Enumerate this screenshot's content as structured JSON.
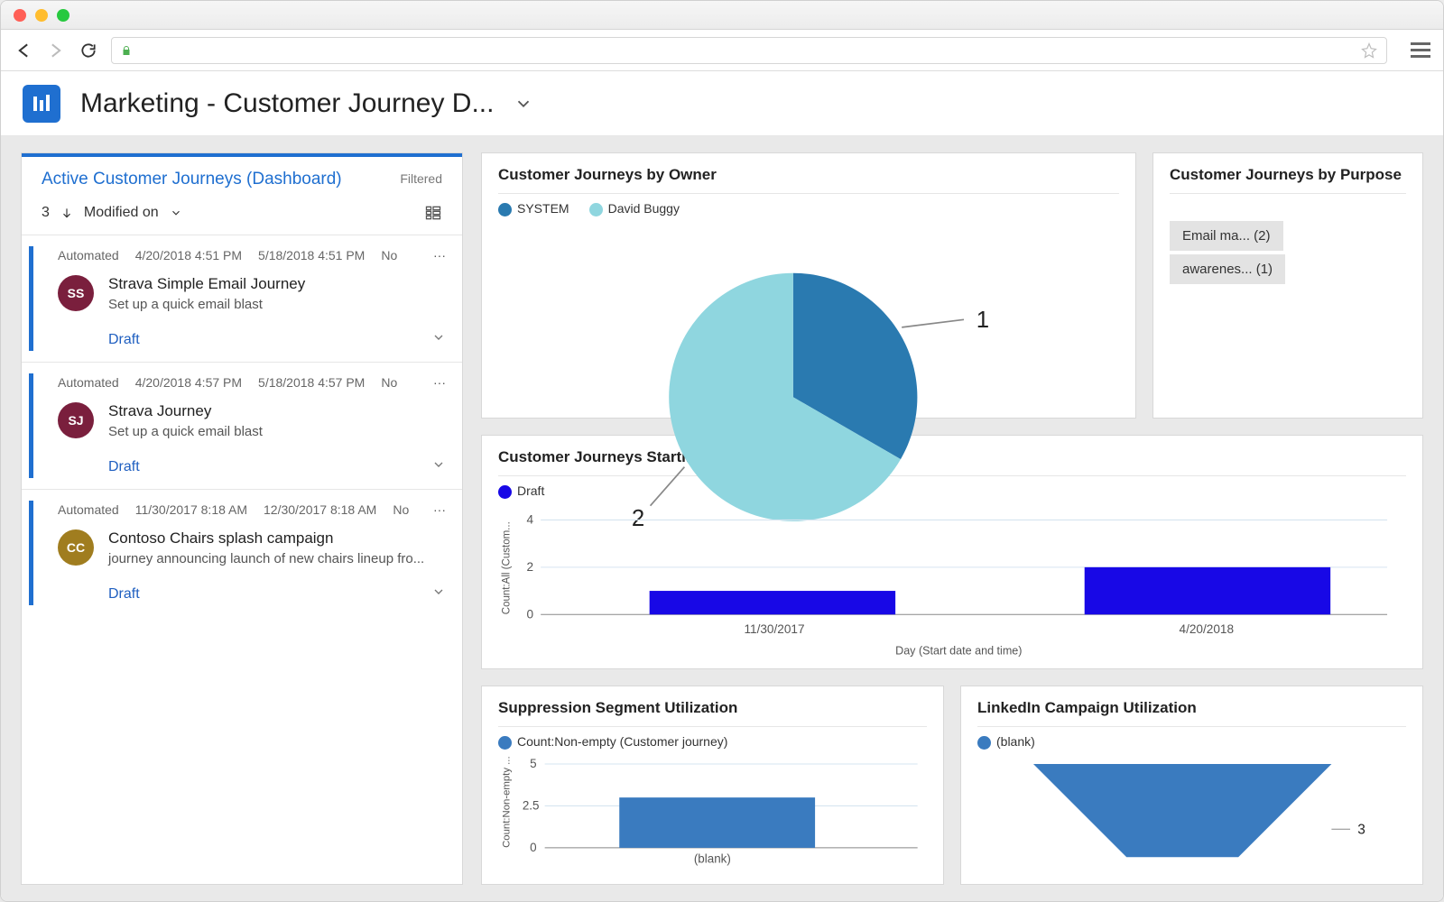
{
  "header": {
    "page_title": "Marketing - Customer Journey D..."
  },
  "left_panel": {
    "title": "Active Customer Journeys (Dashboard)",
    "filtered_label": "Filtered",
    "count": "3",
    "sort_field": "Modified on",
    "items": [
      {
        "type": "Automated",
        "created": "4/20/2018 4:51 PM",
        "modified": "5/18/2018 4:51 PM",
        "flag": "No",
        "initials": "SS",
        "avatar_color": "#7a1f3d",
        "name": "Strava Simple Email Journey",
        "desc": "Set up a quick email blast",
        "status": "Draft"
      },
      {
        "type": "Automated",
        "created": "4/20/2018 4:57 PM",
        "modified": "5/18/2018 4:57 PM",
        "flag": "No",
        "initials": "SJ",
        "avatar_color": "#7a1f3d",
        "name": "Strava Journey",
        "desc": "Set up a quick email blast",
        "status": "Draft"
      },
      {
        "type": "Automated",
        "created": "11/30/2017 8:18 AM",
        "modified": "12/30/2017 8:18 AM",
        "flag": "No",
        "initials": "CC",
        "avatar_color": "#a07d1f",
        "name": "Contoso Chairs splash campaign",
        "desc": "journey announcing launch of new chairs lineup fro...",
        "status": "Draft"
      }
    ]
  },
  "cards": {
    "owner": {
      "title": "Customer Journeys by Owner",
      "legend": [
        {
          "label": "SYSTEM",
          "color": "#2a7ab0"
        },
        {
          "label": "David Buggy",
          "color": "#8fd6df"
        }
      ]
    },
    "purpose": {
      "title": "Customer Journeys by Purpose",
      "tags": [
        "Email ma... (2)",
        "awarenes... (1)"
      ]
    },
    "over_time": {
      "title": "Customer Journeys Starting Over Time",
      "legend_label": "Draft",
      "ylabel": "Count:All (Custom...",
      "xlabel": "Day (Start date and time)"
    },
    "suppression": {
      "title": "Suppression Segment Utilization",
      "legend_label": "Count:Non-empty (Customer journey)",
      "ylabel": "Count:Non-empty ..."
    },
    "linkedin": {
      "title": "LinkedIn Campaign Utilization",
      "legend_label": "(blank)"
    }
  },
  "chart_data": [
    {
      "id": "owner_pie",
      "type": "pie",
      "title": "Customer Journeys by Owner",
      "series": [
        {
          "name": "SYSTEM",
          "value": 1,
          "color": "#2a7ab0"
        },
        {
          "name": "David Buggy",
          "value": 2,
          "color": "#8fd6df"
        }
      ],
      "callouts": [
        "1",
        "2"
      ]
    },
    {
      "id": "over_time_bar",
      "type": "bar",
      "title": "Customer Journeys Starting Over Time",
      "xlabel": "Day (Start date and time)",
      "ylabel": "Count:All (Customer journey)",
      "ylim": [
        0,
        4
      ],
      "yticks": [
        0,
        2,
        4
      ],
      "categories": [
        "11/30/2017",
        "4/20/2018"
      ],
      "series": [
        {
          "name": "Draft",
          "values": [
            1,
            2
          ],
          "color": "#1808e6"
        }
      ]
    },
    {
      "id": "suppression_bar",
      "type": "bar",
      "title": "Suppression Segment Utilization",
      "ylabel": "Count:Non-empty (Customer journey)",
      "ylim": [
        0,
        5
      ],
      "yticks": [
        0,
        2.5,
        5
      ],
      "categories": [
        "(blank)"
      ],
      "series": [
        {
          "name": "Count:Non-empty (Customer journey)",
          "values": [
            3
          ],
          "color": "#3a7bbf"
        }
      ]
    },
    {
      "id": "linkedin_funnel",
      "type": "area",
      "title": "LinkedIn Campaign Utilization",
      "series": [
        {
          "name": "(blank)",
          "value": 3,
          "color": "#3a7bbf"
        }
      ],
      "callout": "3"
    }
  ]
}
